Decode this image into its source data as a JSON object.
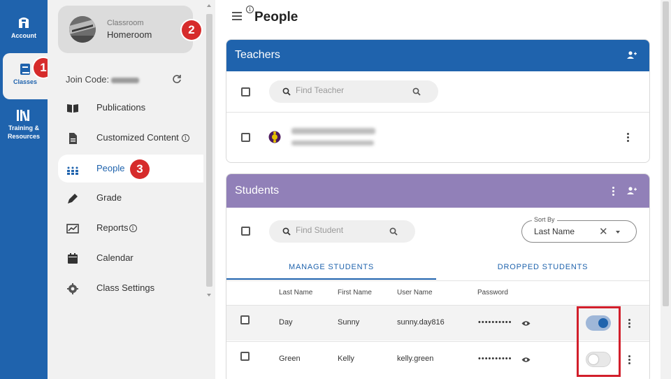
{
  "rail": {
    "account_label": "Account",
    "classes_label": "Classes",
    "training_label_1": "Training &",
    "training_label_2": "Resources"
  },
  "badges": {
    "one": "1",
    "two": "2",
    "three": "3"
  },
  "class_selector": {
    "subtitle": "Classroom",
    "name": "Homeroom"
  },
  "join_code_label": "Join Code:",
  "nav": {
    "publications": "Publications",
    "customized_content": "Customized Content",
    "people": "People",
    "grade": "Grade",
    "reports": "Reports",
    "calendar": "Calendar",
    "class_settings": "Class Settings"
  },
  "page_title": "People",
  "teachers": {
    "title": "Teachers",
    "search_placeholder": "Find Teacher"
  },
  "students": {
    "title": "Students",
    "search_placeholder": "Find Student",
    "sort_legend": "Sort By",
    "sort_value": "Last Name",
    "tabs": {
      "manage": "MANAGE STUDENTS",
      "dropped": "DROPPED STUDENTS"
    },
    "headers": {
      "last": "Last Name",
      "first": "First Name",
      "user": "User Name",
      "password": "Password"
    },
    "rows": [
      {
        "last": "Day",
        "first": "Sunny",
        "user": "sunny.day816",
        "password": "••••••••••",
        "enabled": true
      },
      {
        "last": "Green",
        "first": "Kelly",
        "user": "kelly.green",
        "password": "••••••••••",
        "enabled": false
      }
    ]
  },
  "colors": {
    "brand": "#1f63ad",
    "students_header": "#9180b8",
    "badge": "#d62b2b"
  }
}
